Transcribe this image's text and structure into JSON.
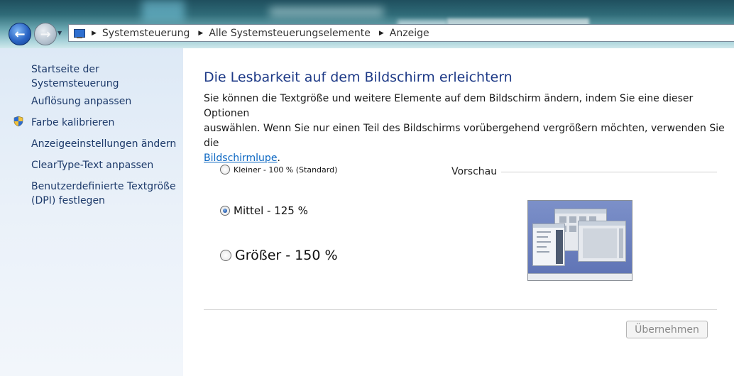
{
  "breadcrumb": [
    "Systemsteuerung",
    "Alle Systemsteuerungselemente",
    "Anzeige"
  ],
  "icons": {
    "back": "back-arrow-icon",
    "forward": "forward-arrow-icon",
    "address": "display-control-panel-icon",
    "shield": "uac-shield-icon"
  },
  "sidebar": {
    "home": "Startseite der Systemsteuerung",
    "items": [
      "Auflösung anpassen",
      "Farbe kalibrieren",
      "Anzeigeeinstellungen ändern",
      "ClearType-Text anpassen",
      "Benutzerdefinierte Textgröße",
      "(DPI) festlegen"
    ]
  },
  "main": {
    "title": "Die Lesbarkeit auf dem Bildschirm erleichtern",
    "desc_line1": "Sie können die Textgröße und weitere Elemente auf dem Bildschirm ändern, indem Sie eine dieser Optionen",
    "desc_line2": "auswählen. Wenn Sie nur einen Teil des Bildschirms vorübergehend vergrößern möchten, verwenden Sie die",
    "desc_link": "Bildschirmlupe",
    "desc_end": ".",
    "options": [
      {
        "label": "Kleiner - 100 % (Standard)",
        "checked": false
      },
      {
        "label": "Mittel - 125 %",
        "checked": true
      },
      {
        "label": "Größer - 150 %",
        "checked": false
      }
    ],
    "preview_label": "Vorschau",
    "apply_button": "Übernehmen"
  },
  "colors": {
    "title": "#1e3a87",
    "sidebar_link": "#1e3b6b",
    "link": "#0a66c2"
  }
}
